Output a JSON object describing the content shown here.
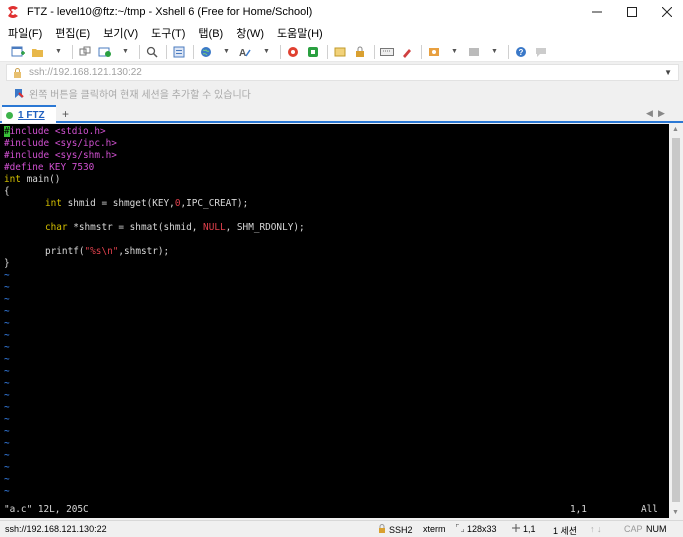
{
  "window": {
    "title": "FTZ - level10@ftz:~/tmp - Xshell 6 (Free for Home/School)"
  },
  "menu": {
    "items": [
      "파일(F)",
      "편집(E)",
      "보기(V)",
      "도구(T)",
      "탭(B)",
      "창(W)",
      "도움말(H)"
    ]
  },
  "address": {
    "value": "ssh://192.168.121.130:22"
  },
  "hint": {
    "text": "왼쪽 버튼을 클릭하여 현재 세션을 추가할 수 있습니다"
  },
  "tabs": {
    "active_label": "1 FTZ",
    "add_label": "+",
    "prev_label": "◀",
    "next_label": "▶"
  },
  "terminal": {
    "cursor_char": "#",
    "lines": [
      {
        "pre": "include ",
        "inc": "<stdio.h>"
      },
      {
        "pre": "#include ",
        "inc": "<sys/ipc.h>"
      },
      {
        "pre": "#include ",
        "inc": "<sys/shm.h>"
      },
      {
        "define": "#define KEY 7530"
      },
      {
        "type": "int",
        "rest": " main()"
      },
      {
        "plain": "{"
      },
      {
        "type": "int",
        "rest": " shmid = shmget(KEY,",
        "num": "0",
        "rest2": ",IPC_CREAT);"
      },
      {
        "type": "char",
        "rest": " *shmstr = shmat(shmid, ",
        "const": "NULL",
        "rest2": ", SHM_RDONLY);"
      },
      {
        "fn": "printf(",
        "str": "\"%s\\n\"",
        "rest": ",shmstr);"
      },
      {
        "plain": "}"
      }
    ],
    "tilde": "~",
    "status_file": "\"a.c\" 12L, 205C",
    "status_pos": "1,1",
    "status_all": "All"
  },
  "statusbar": {
    "connection": "ssh://192.168.121.130:22",
    "protocol": "SSH2",
    "terminal_type": "xterm",
    "size": "128x33",
    "cursor_pos": "1,1",
    "sessions": "1 세션",
    "arrows": "↑ ↓",
    "cap": "CAP",
    "num": "NUM"
  },
  "colors": {
    "accent": "#2b78d4",
    "terminal_bg": "#000000",
    "preprocessor": "#d050d0",
    "type": "#d4c000",
    "constant": "#e0404c",
    "tilde": "#3b8cff",
    "cursor": "#38c038"
  },
  "icons": {
    "app": "xshell-logo-icon",
    "minimize": "minimize-icon",
    "maximize": "maximize-icon",
    "close": "close-icon"
  }
}
